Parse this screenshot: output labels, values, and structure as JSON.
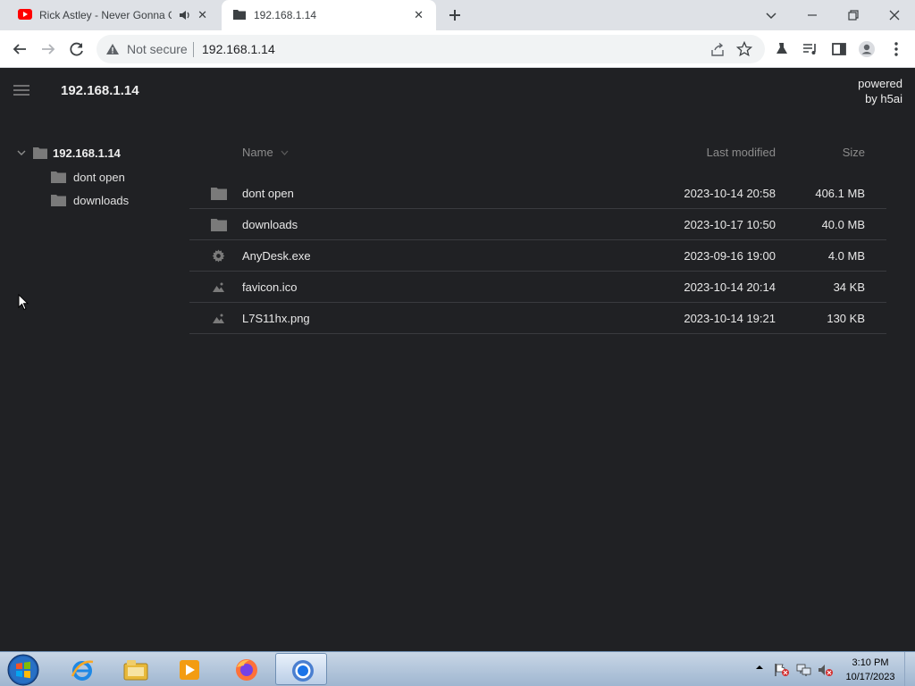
{
  "browser": {
    "tabs": [
      {
        "title": "Rick Astley - Never Gonna Give You Up",
        "favicon": "youtube-icon",
        "audio": "speaker-icon"
      },
      {
        "title": "192.168.1.14",
        "favicon": "folder-icon"
      }
    ],
    "address": {
      "security": "Not secure",
      "url": "192.168.1.14"
    }
  },
  "page": {
    "title": "192.168.1.14",
    "powered_line1": "powered",
    "powered_line2": "by h5ai",
    "tree": {
      "root": "192.168.1.14",
      "children": [
        "dont open",
        "downloads"
      ]
    },
    "headers": {
      "name": "Name",
      "modified": "Last modified",
      "size": "Size"
    },
    "files": [
      {
        "name": "dont open",
        "modified": "2023-10-14 20:58",
        "size": "406.1 MB",
        "icon": "folder-icon"
      },
      {
        "name": "downloads",
        "modified": "2023-10-17 10:50",
        "size": "40.0 MB",
        "icon": "folder-icon"
      },
      {
        "name": "AnyDesk.exe",
        "modified": "2023-09-16 19:00",
        "size": "4.0 MB",
        "icon": "gear-icon"
      },
      {
        "name": "favicon.ico",
        "modified": "2023-10-14 20:14",
        "size": "34 KB",
        "icon": "image-icon"
      },
      {
        "name": "L7S11hx.png",
        "modified": "2023-10-14 19:21",
        "size": "130 KB",
        "icon": "image-icon"
      }
    ]
  },
  "taskbar": {
    "time": "3:10 PM",
    "date": "10/17/2023"
  },
  "colors": {
    "page_bg": "#202124",
    "tab_strip": "#dee1e6",
    "taskbar": "#a9bfd8"
  }
}
